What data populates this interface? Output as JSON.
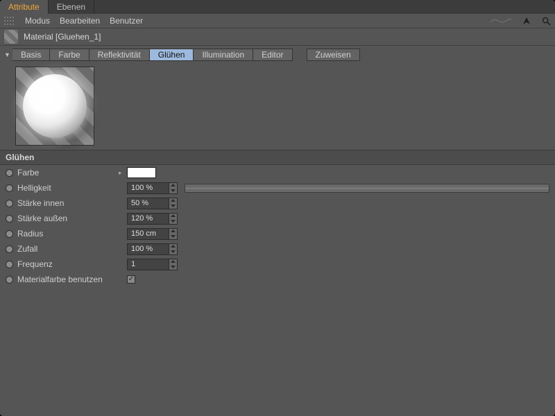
{
  "top_tabs": {
    "attribute": "Attribute",
    "ebenen": "Ebenen"
  },
  "menu": {
    "modus": "Modus",
    "bearbeiten": "Bearbeiten",
    "benutzer": "Benutzer"
  },
  "material": {
    "title": "Material [Gluehen_1]"
  },
  "channels": {
    "basis": "Basis",
    "farbe": "Farbe",
    "reflektivitaet": "Reflektivität",
    "gluehen": "Glühen",
    "illumination": "Illumination",
    "editor": "Editor",
    "zuweisen": "Zuweisen"
  },
  "section_heading": "Glühen",
  "params": {
    "farbe": {
      "label": "Farbe",
      "color": "#ffffff"
    },
    "helligkeit": {
      "label": "Helligkeit",
      "value": "100 %"
    },
    "staerke_innen": {
      "label": "Stärke innen",
      "value": "50 %"
    },
    "staerke_aussen": {
      "label": "Stärke außen",
      "value": "120 %"
    },
    "radius": {
      "label": "Radius",
      "value": "150 cm"
    },
    "zufall": {
      "label": "Zufall",
      "value": "100 %"
    },
    "frequenz": {
      "label": "Frequenz",
      "value": "1"
    },
    "materialfarbe": {
      "label": "Materialfarbe benutzen",
      "checked": true
    }
  }
}
